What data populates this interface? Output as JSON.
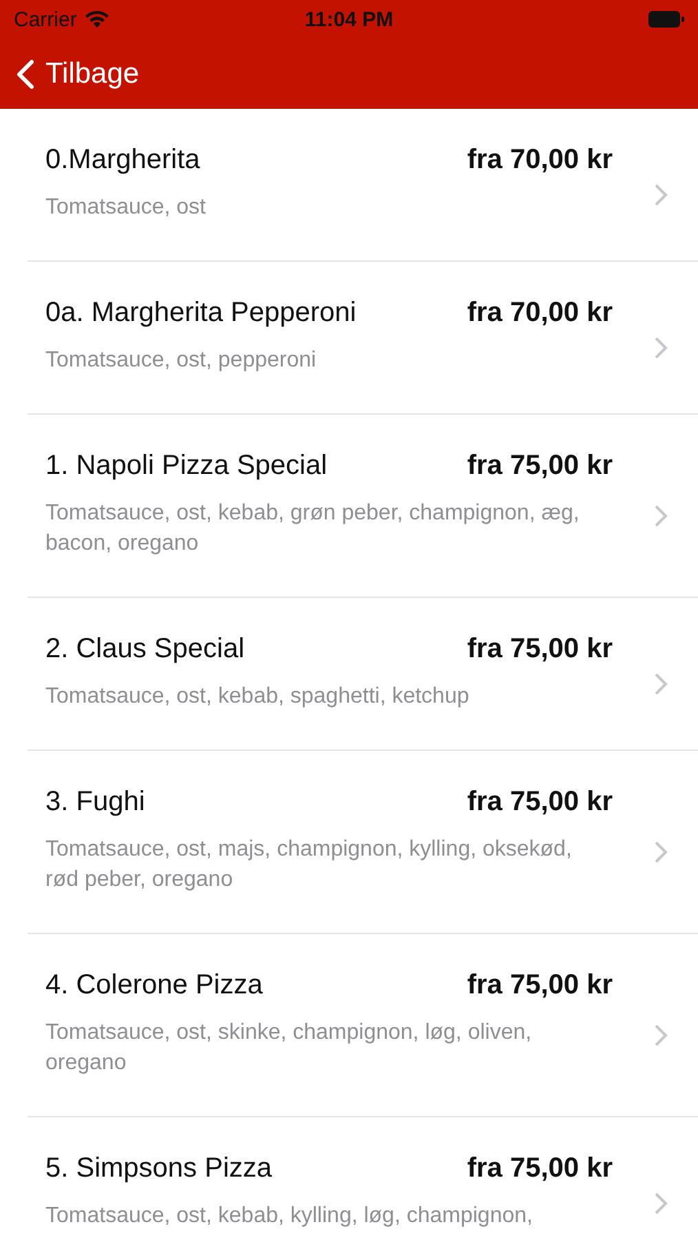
{
  "status_bar": {
    "carrier": "Carrier",
    "time": "11:04 PM"
  },
  "nav": {
    "back_label": "Tilbage"
  },
  "items": [
    {
      "name": "0.Margherita",
      "price": "fra 70,00 kr",
      "description": "Tomatsauce, ost"
    },
    {
      "name": "0a. Margherita Pepperoni",
      "price": "fra 70,00 kr",
      "description": "Tomatsauce, ost, pepperoni"
    },
    {
      "name": "1. Napoli Pizza Special",
      "price": "fra 75,00 kr",
      "description": "Tomatsauce, ost, kebab, grøn peber, champignon, æg, bacon, oregano"
    },
    {
      "name": "2. Claus Special",
      "price": "fra 75,00 kr",
      "description": "Tomatsauce, ost, kebab, spaghetti, ketchup"
    },
    {
      "name": "3. Fughi",
      "price": "fra 75,00 kr",
      "description": "Tomatsauce, ost, majs, champignon, kylling, oksekød, rød peber, oregano"
    },
    {
      "name": "4. Colerone Pizza",
      "price": "fra 75,00 kr",
      "description": "Tomatsauce, ost, skinke, champignon, løg, oliven, oregano"
    },
    {
      "name": "5. Simpsons Pizza",
      "price": "fra 75,00 kr",
      "description": "Tomatsauce, ost, kebab, kylling, løg, champignon,"
    }
  ]
}
